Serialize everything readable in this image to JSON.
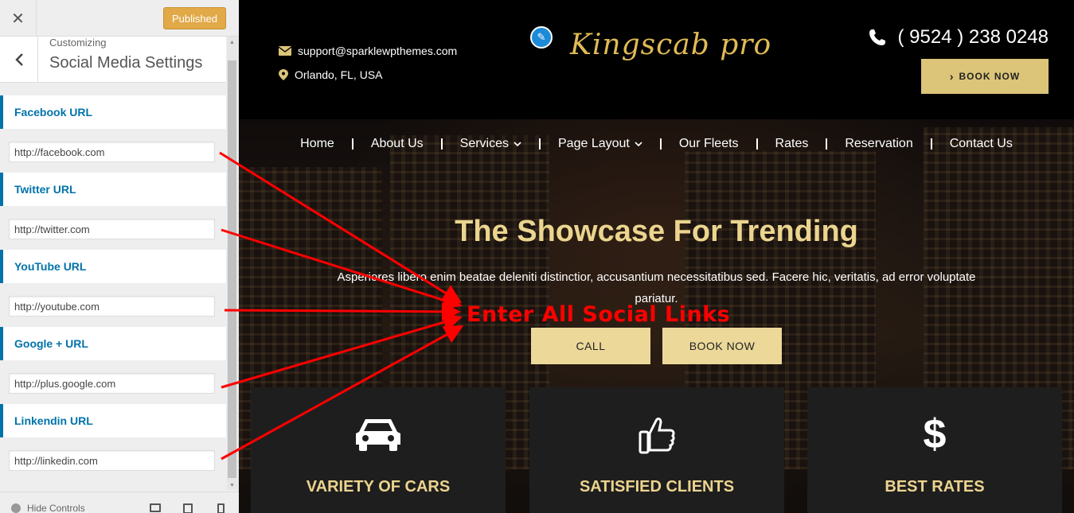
{
  "sidebar": {
    "close_icon": "close-icon",
    "publish_label": "Published",
    "back_icon": "chevron-left-icon",
    "breadcrumb": "Customizing",
    "section_title": "Social Media Settings",
    "controls": [
      {
        "label": "Facebook URL",
        "value": "http://facebook.com"
      },
      {
        "label": "Twitter URL",
        "value": "http://twitter.com"
      },
      {
        "label": "YouTube URL",
        "value": "http://youtube.com"
      },
      {
        "label": "Google + URL",
        "value": "http://plus.google.com"
      },
      {
        "label": "Linkendin URL",
        "value": "http://linkedin.com"
      }
    ],
    "hide_controls_label": "Hide Controls",
    "accent": "#0073aa"
  },
  "preview": {
    "email": "support@sparklewpthemes.com",
    "location": "Orlando, FL, USA",
    "logo": "Kingscab pro",
    "phone": "( 9524 ) 238 0248",
    "book_top": "BOOK NOW",
    "nav": [
      "Home",
      "About Us",
      "Services",
      "Page Layout",
      "Our Fleets",
      "Rates",
      "Reservation",
      "Contact Us"
    ],
    "hero_title": "The Showcase For Trending",
    "hero_desc": "Asperiores libero enim beatae deleniti distinctior, accusantium necessitatibus sed. Facere hic, veritatis, ad error voluptate pariatur.",
    "call_label": "CALL",
    "book_label": "BOOK NOW",
    "features": [
      {
        "title": "VARIETY OF CARS",
        "icon": "car-icon"
      },
      {
        "title": "SATISFIED CLIENTS",
        "icon": "thumbs-up-icon"
      },
      {
        "title": "BEST RATES",
        "icon": "dollar-icon"
      }
    ],
    "accent": "#dcc578"
  },
  "annotation": {
    "text": "Enter All Social Links",
    "color": "#ff0000"
  }
}
